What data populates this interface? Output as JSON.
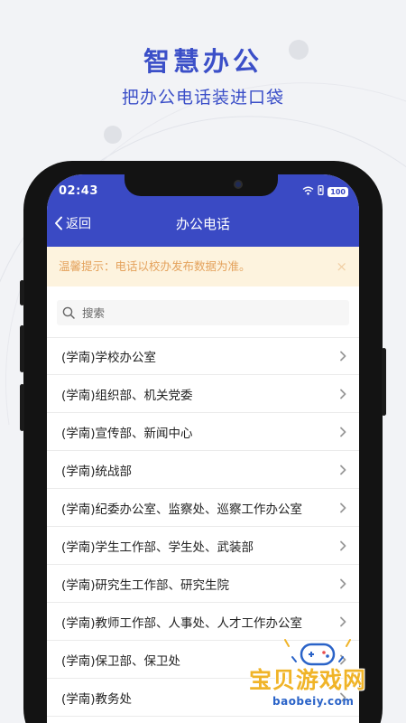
{
  "promo": {
    "title": "智慧办公",
    "subtitle": "把办公电话装进口袋"
  },
  "status_bar": {
    "time": "02:43",
    "battery": "100"
  },
  "nav": {
    "back_label": "返回",
    "title": "办公电话"
  },
  "notice": {
    "text": "温馨提示：电话以校办发布数据为准。",
    "close_symbol": "×"
  },
  "search": {
    "placeholder": "搜索"
  },
  "departments": [
    "(学南)学校办公室",
    "(学南)组织部、机关党委",
    "(学南)宣传部、新闻中心",
    "(学南)统战部",
    "(学南)纪委办公室、监察处、巡察工作办公室",
    "(学南)学生工作部、学生处、武装部",
    "(学南)研究生工作部、研究生院",
    "(学南)教师工作部、人事处、人才工作办公室",
    "(学南)保卫部、保卫处",
    "(学南)教务处"
  ],
  "watermark": {
    "text": "宝贝游戏网",
    "url": "baobeiy.com"
  },
  "colors": {
    "brand": "#3a4ac4",
    "promo_text": "#3b4fc8",
    "notice_bg": "#fdf3de",
    "notice_text": "#e4a25c",
    "watermark_text": "#f0b428",
    "watermark_url": "#2a63c8"
  },
  "icons": {
    "back": "chevron-left-icon",
    "search": "search-icon",
    "row_arrow": "chevron-right-icon",
    "wifi": "wifi-icon",
    "vibrate": "vibrate-icon",
    "battery": "battery-icon",
    "close": "close-icon",
    "watermark_logo": "gamepad-icon"
  }
}
